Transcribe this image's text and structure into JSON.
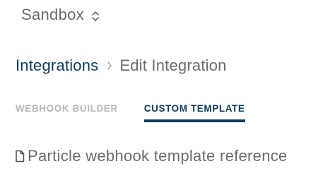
{
  "org_switcher": {
    "name": "Sandbox",
    "icon": "chevron-up-down-icon"
  },
  "breadcrumb": {
    "parent": "Integrations",
    "separator_icon": "chevron-right-icon",
    "current": "Edit Integration"
  },
  "tabs": [
    {
      "label": "WEBHOOK BUILDER",
      "active": false
    },
    {
      "label": "CUSTOM TEMPLATE",
      "active": true
    }
  ],
  "reference_link": {
    "icon": "document-icon",
    "label": "Particle webhook template reference"
  },
  "colors": {
    "primary_navy": "#0f3a5a",
    "muted_gray": "#6b6b6b",
    "inactive_tab": "#b8b8b8"
  }
}
